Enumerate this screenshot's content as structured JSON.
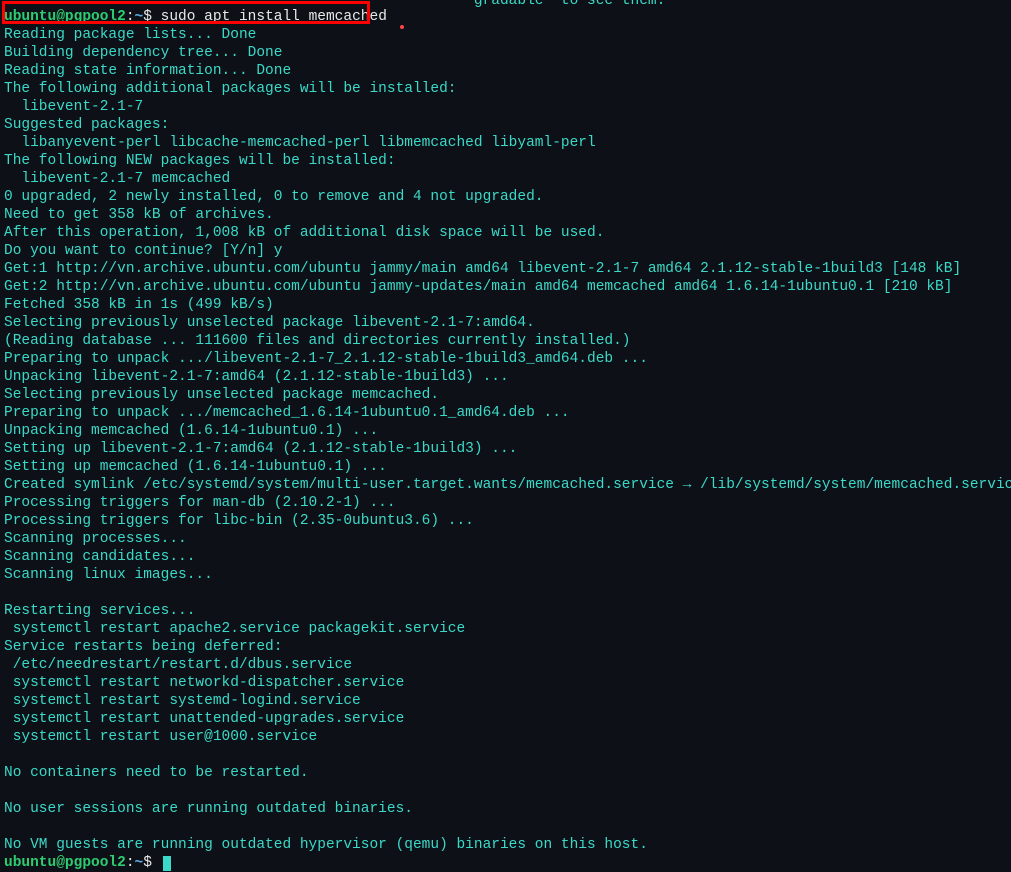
{
  "topFragment": "                                                      gradable  to see them.",
  "prompt1": {
    "user": "ubuntu",
    "at": "@",
    "host": "pgpool2",
    "colon": ":",
    "path": "~",
    "dollar": "$ ",
    "command": "sudo apt install memcached"
  },
  "output": [
    "Reading package lists... Done",
    "Building dependency tree... Done",
    "Reading state information... Done",
    "The following additional packages will be installed:",
    "  libevent-2.1-7",
    "Suggested packages:",
    "  libanyevent-perl libcache-memcached-perl libmemcached libyaml-perl",
    "The following NEW packages will be installed:",
    "  libevent-2.1-7 memcached",
    "0 upgraded, 2 newly installed, 0 to remove and 4 not upgraded.",
    "Need to get 358 kB of archives.",
    "After this operation, 1,008 kB of additional disk space will be used.",
    "Do you want to continue? [Y/n] y",
    "Get:1 http://vn.archive.ubuntu.com/ubuntu jammy/main amd64 libevent-2.1-7 amd64 2.1.12-stable-1build3 [148 kB]",
    "Get:2 http://vn.archive.ubuntu.com/ubuntu jammy-updates/main amd64 memcached amd64 1.6.14-1ubuntu0.1 [210 kB]",
    "Fetched 358 kB in 1s (499 kB/s)",
    "Selecting previously unselected package libevent-2.1-7:amd64.",
    "(Reading database ... 111600 files and directories currently installed.)",
    "Preparing to unpack .../libevent-2.1-7_2.1.12-stable-1build3_amd64.deb ...",
    "Unpacking libevent-2.1-7:amd64 (2.1.12-stable-1build3) ...",
    "Selecting previously unselected package memcached.",
    "Preparing to unpack .../memcached_1.6.14-1ubuntu0.1_amd64.deb ...",
    "Unpacking memcached (1.6.14-1ubuntu0.1) ...",
    "Setting up libevent-2.1-7:amd64 (2.1.12-stable-1build3) ...",
    "Setting up memcached (1.6.14-1ubuntu0.1) ...",
    "Created symlink /etc/systemd/system/multi-user.target.wants/memcached.service → /lib/systemd/system/memcached.service.",
    "Processing triggers for man-db (2.10.2-1) ...",
    "Processing triggers for libc-bin (2.35-0ubuntu3.6) ...",
    "Scanning processes...",
    "Scanning candidates...",
    "Scanning linux images...",
    "",
    "Restarting services...",
    " systemctl restart apache2.service packagekit.service",
    "Service restarts being deferred:",
    " /etc/needrestart/restart.d/dbus.service",
    " systemctl restart networkd-dispatcher.service",
    " systemctl restart systemd-logind.service",
    " systemctl restart unattended-upgrades.service",
    " systemctl restart user@1000.service",
    "",
    "No containers need to be restarted.",
    "",
    "No user sessions are running outdated binaries.",
    "",
    "No VM guests are running outdated hypervisor (qemu) binaries on this host."
  ],
  "prompt2": {
    "user": "ubuntu",
    "at": "@",
    "host": "pgpool2",
    "colon": ":",
    "path": "~",
    "dollar": "$ "
  }
}
